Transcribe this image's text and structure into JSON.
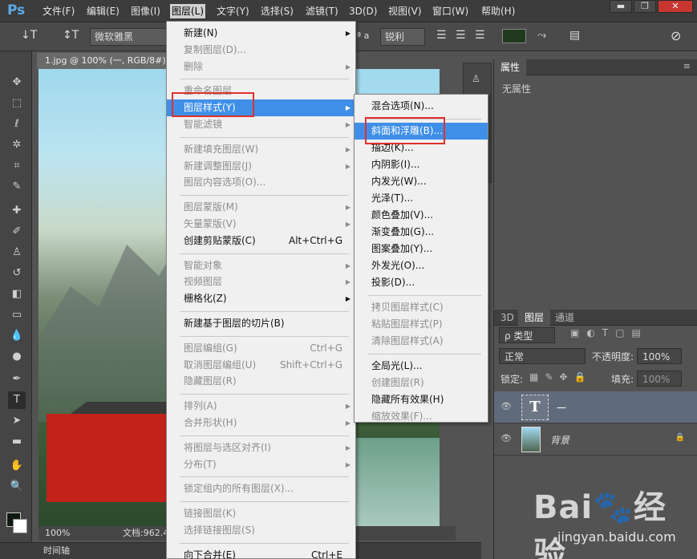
{
  "menubar": {
    "logo": "Ps",
    "items": [
      "文件(F)",
      "编辑(E)",
      "图像(I)",
      "图层(L)",
      "文字(Y)",
      "选择(S)",
      "滤镜(T)",
      "3D(D)",
      "视图(V)",
      "窗口(W)",
      "帮助(H)"
    ],
    "active_index": 3,
    "window_buttons": [
      "▬",
      "❐",
      "✕"
    ]
  },
  "options": {
    "tool_glyph": "↓T",
    "orient_glyph": "↕T",
    "font_family": "微软雅黑",
    "aa_prefix": "ª a",
    "antialias": "锐利",
    "color": "#1f3a1f"
  },
  "document": {
    "tab_title": "1.jpg @ 100% (一, RGB/8#)",
    "zoom": "100%",
    "doc_info": "文档:962.4"
  },
  "timeline": {
    "label": "时间轴"
  },
  "properties": {
    "tab": "属性",
    "empty_text": "无属性"
  },
  "layers_panel": {
    "tabs": [
      "3D",
      "图层",
      "通道"
    ],
    "active_tab": 1,
    "filter_label": "ρ 类型",
    "blend_mode": "正常",
    "opacity_label": "不透明度:",
    "opacity_value": "100%",
    "lock_label": "锁定:",
    "fill_label": "填充:",
    "fill_value": "100%",
    "layers": [
      {
        "name": "一",
        "thumb": "T",
        "selected": true
      },
      {
        "name": "背景",
        "thumb": "",
        "selected": false,
        "locked": true
      }
    ]
  },
  "layer_menu": {
    "items": [
      {
        "label": "新建(N)",
        "arrow": true
      },
      {
        "label": "复制图层(D)...",
        "disabled": true
      },
      {
        "label": "删除",
        "disabled": true,
        "arrow": true
      },
      {
        "sep": true
      },
      {
        "label": "重命名图层...",
        "disabled": true
      },
      {
        "label": "图层样式(Y)",
        "arrow": true,
        "highlighted": true
      },
      {
        "label": "智能滤镜",
        "disabled": true,
        "arrow": true
      },
      {
        "sep": true
      },
      {
        "label": "新建填充图层(W)",
        "disabled": true,
        "arrow": true
      },
      {
        "label": "新建调整图层(J)",
        "disabled": true,
        "arrow": true
      },
      {
        "label": "图层内容选项(O)...",
        "disabled": true
      },
      {
        "sep": true
      },
      {
        "label": "图层蒙版(M)",
        "disabled": true,
        "arrow": true
      },
      {
        "label": "矢量蒙版(V)",
        "disabled": true,
        "arrow": true
      },
      {
        "label": "创建剪贴蒙版(C)",
        "shortcut": "Alt+Ctrl+G"
      },
      {
        "sep": true
      },
      {
        "label": "智能对象",
        "disabled": true,
        "arrow": true
      },
      {
        "label": "视频图层",
        "disabled": true,
        "arrow": true
      },
      {
        "label": "栅格化(Z)",
        "arrow": true
      },
      {
        "sep": true
      },
      {
        "label": "新建基于图层的切片(B)"
      },
      {
        "sep": true
      },
      {
        "label": "图层编组(G)",
        "disabled": true,
        "shortcut": "Ctrl+G"
      },
      {
        "label": "取消图层编组(U)",
        "disabled": true,
        "shortcut": "Shift+Ctrl+G"
      },
      {
        "label": "隐藏图层(R)",
        "disabled": true
      },
      {
        "sep": true
      },
      {
        "label": "排列(A)",
        "disabled": true,
        "arrow": true
      },
      {
        "label": "合并形状(H)",
        "disabled": true,
        "arrow": true
      },
      {
        "sep": true
      },
      {
        "label": "将图层与选区对齐(I)",
        "disabled": true,
        "arrow": true
      },
      {
        "label": "分布(T)",
        "disabled": true,
        "arrow": true
      },
      {
        "sep": true
      },
      {
        "label": "锁定组内的所有图层(X)...",
        "disabled": true
      },
      {
        "sep": true
      },
      {
        "label": "链接图层(K)",
        "disabled": true
      },
      {
        "label": "选择链接图层(S)",
        "disabled": true
      },
      {
        "sep": true
      },
      {
        "label": "向下合并(E)",
        "shortcut": "Ctrl+E"
      }
    ]
  },
  "style_submenu": {
    "items": [
      {
        "label": "混合选项(N)..."
      },
      {
        "sep": true
      },
      {
        "label": "斜面和浮雕(B)...",
        "highlighted": true
      },
      {
        "label": "描边(K)..."
      },
      {
        "label": "内阴影(I)..."
      },
      {
        "label": "内发光(W)..."
      },
      {
        "label": "光泽(T)..."
      },
      {
        "label": "颜色叠加(V)..."
      },
      {
        "label": "渐变叠加(G)..."
      },
      {
        "label": "图案叠加(Y)..."
      },
      {
        "label": "外发光(O)..."
      },
      {
        "label": "投影(D)..."
      },
      {
        "sep": true
      },
      {
        "label": "拷贝图层样式(C)",
        "disabled": true
      },
      {
        "label": "粘贴图层样式(P)",
        "disabled": true
      },
      {
        "label": "清除图层样式(A)",
        "disabled": true
      },
      {
        "sep": true
      },
      {
        "label": "全局光(L)..."
      },
      {
        "label": "创建图层(R)",
        "disabled": true
      },
      {
        "label": "隐藏所有效果(H)"
      },
      {
        "label": "缩放效果(F)...",
        "disabled": true
      }
    ]
  },
  "watermark": {
    "brand": "Bai🐾经验",
    "url": "jingyan.baidu.com"
  }
}
